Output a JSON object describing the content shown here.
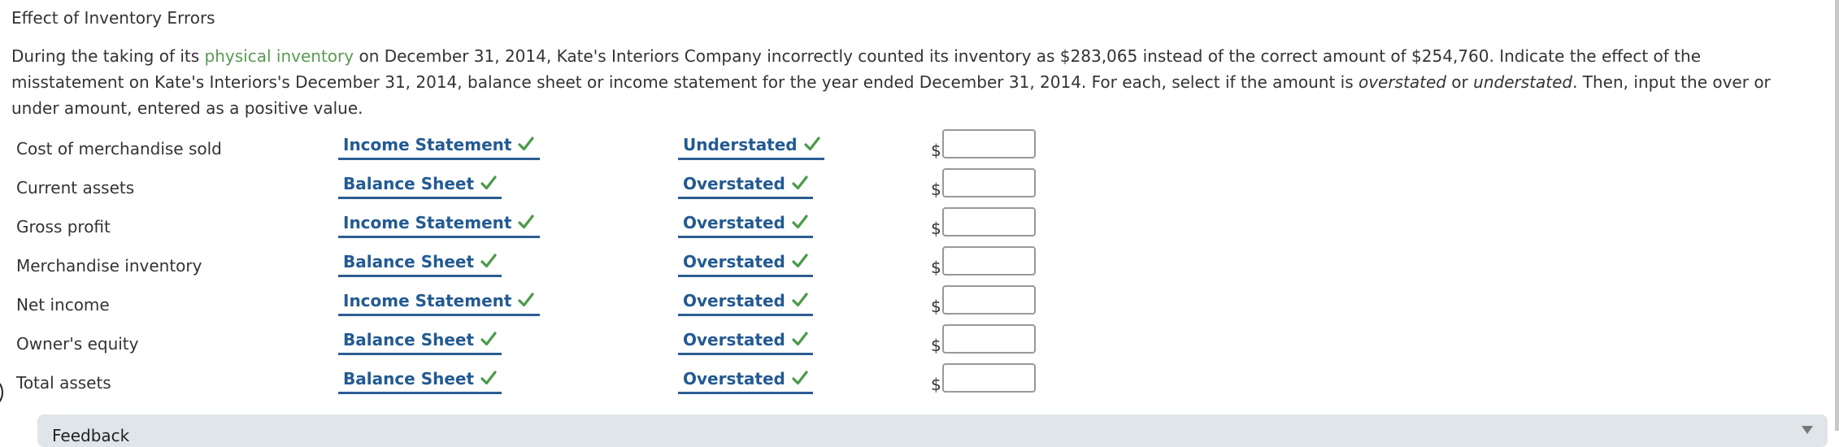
{
  "title": "Effect of Inventory Errors",
  "instructions": {
    "part1": "During the taking of its ",
    "link": "physical inventory",
    "part2": " on December 31, 2014, Kate's Interiors Company incorrectly counted its inventory as $283,065 instead of the correct amount of $254,760. Indicate the effect of the misstatement on Kate's Interiors's December 31, 2014, balance sheet or income statement for the year ended December 31, 2014. For each, select if the amount is ",
    "em1": "overstated",
    "part3": " or ",
    "em2": "understated",
    "part4": ". Then, input the over or under amount, entered as a positive value."
  },
  "currency_symbol": "$",
  "rows": [
    {
      "label": "Cost of merchandise sold",
      "statement": "Income Statement",
      "effect": "Understated",
      "amount": ""
    },
    {
      "label": "Current assets",
      "statement": "Balance Sheet",
      "effect": "Overstated",
      "amount": ""
    },
    {
      "label": "Gross profit",
      "statement": "Income Statement",
      "effect": "Overstated",
      "amount": ""
    },
    {
      "label": "Merchandise inventory",
      "statement": "Balance Sheet",
      "effect": "Overstated",
      "amount": ""
    },
    {
      "label": "Net income",
      "statement": "Income Statement",
      "effect": "Overstated",
      "amount": ""
    },
    {
      "label": "Owner's equity",
      "statement": "Balance Sheet",
      "effect": "Overstated",
      "amount": ""
    },
    {
      "label": "Total assets",
      "statement": "Balance Sheet",
      "effect": "Overstated",
      "amount": ""
    }
  ],
  "status_icon": "checkmark-icon",
  "colors": {
    "dropdown_text": "#235a92",
    "check": "#4a9a48",
    "link": "#5b9a54",
    "feedback_bg": "#dfe5e8"
  },
  "feedback": {
    "label": "Feedback"
  }
}
